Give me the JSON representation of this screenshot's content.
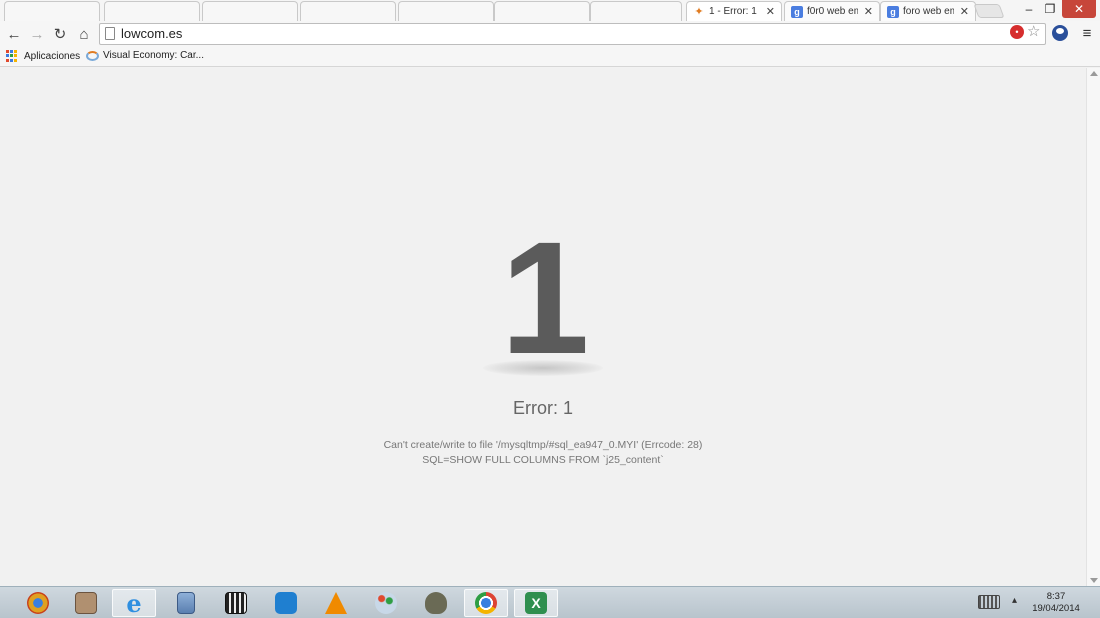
{
  "browser": {
    "tabs": [
      {
        "label": "1 - Error: 1",
        "icon": "joomla-icon",
        "active": true
      },
      {
        "label": "f0r0 web em",
        "icon": "google-icon",
        "active": false
      },
      {
        "label": "foro web em",
        "icon": "google-icon",
        "active": false
      }
    ],
    "address": {
      "url": "lowcom.es"
    },
    "bookmarks": [
      {
        "label": "Aplicaciones",
        "icon": "apps-icon"
      },
      {
        "label": "Visual Economy: Car...",
        "icon": "visual-economy-icon"
      }
    ]
  },
  "page": {
    "big_number": "1",
    "error_title": "Error: 1",
    "message_line1": "Can't create/write to file '/mysqltmp/#sql_ea947_0.MYI' (Errcode: 28)",
    "message_line2": "SQL=SHOW FULL COLUMNS FROM `j25_content`"
  },
  "taskbar": {
    "apps": [
      {
        "name": "chrome-canary-icon",
        "color": "#e0a020"
      },
      {
        "name": "file-manager-icon",
        "color": "#b09070"
      },
      {
        "name": "internet-explorer-icon",
        "color": "#2f8fe0"
      },
      {
        "name": "calculator-icon",
        "color": "#6a8fc0"
      },
      {
        "name": "movie-maker-icon",
        "color": "#444444"
      },
      {
        "name": "teamviewer-icon",
        "color": "#1f7fd0"
      },
      {
        "name": "vlc-icon",
        "color": "#f08a00"
      },
      {
        "name": "paint-icon",
        "color": "#8fb0d0"
      },
      {
        "name": "gimp-icon",
        "color": "#6a6a55"
      },
      {
        "name": "chrome-icon",
        "color": "#dd4433"
      },
      {
        "name": "excel-icon",
        "color": "#2f8f4f"
      }
    ],
    "clock": {
      "time": "8:37",
      "date": "19/04/2014"
    }
  }
}
